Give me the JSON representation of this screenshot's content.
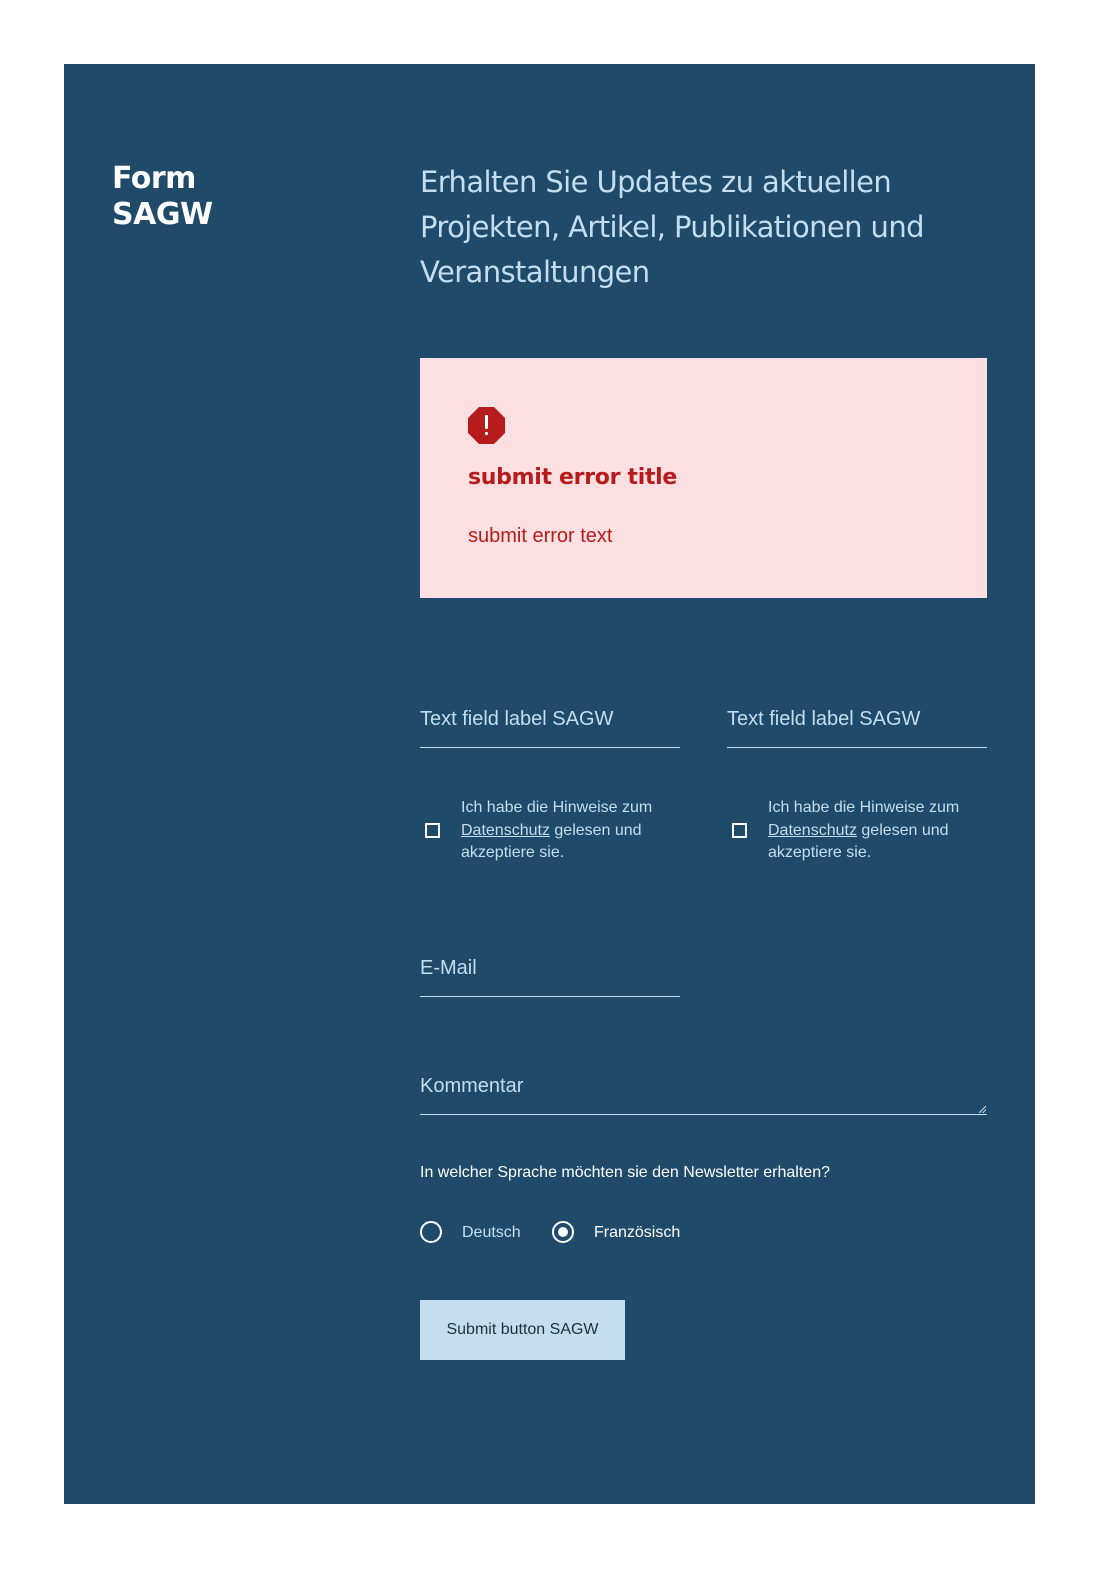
{
  "form": {
    "title_line1": "Form",
    "title_line2": "SAGW",
    "intro": "Erhalten Sie Updates zu aktuellen Projekten, Artikel, Publikationen und Veranstaltungen"
  },
  "error": {
    "icon": "error-octagon-icon",
    "title": "submit error title",
    "text": "submit error text"
  },
  "fields": {
    "text_field_1_label": "Text field label SAGW",
    "text_field_2_label": "Text field label SAGW",
    "email_label": "E-Mail",
    "comment_label": "Kommentar"
  },
  "privacy": {
    "before": "Ich habe die Hinweise zum",
    "link": "Datenschutz",
    "after": "gelesen und akzeptiere sie."
  },
  "language": {
    "question": "In welcher Sprache möchten sie den Newsletter erhalten?",
    "options": [
      {
        "label": "Deutsch",
        "checked": false
      },
      {
        "label": "Französisch",
        "checked": true
      }
    ]
  },
  "submit_label": "Submit button SAGW",
  "colors": {
    "panel_bg": "#1f4a69",
    "accent_light": "#c4def0",
    "error_bg": "#fce0e1",
    "error_red": "#b71c1c"
  }
}
